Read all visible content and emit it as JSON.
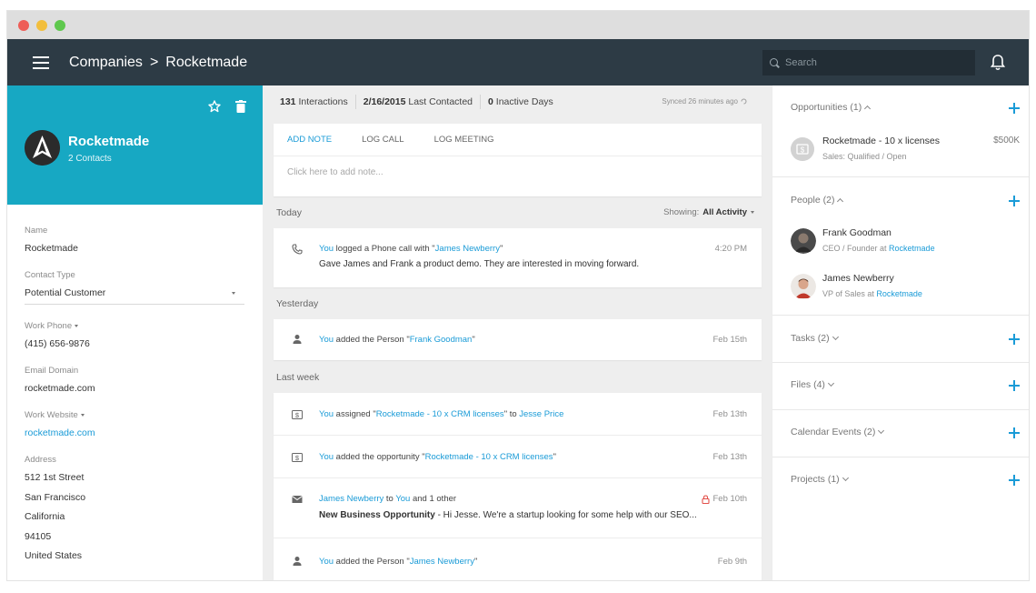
{
  "window": {
    "controls": [
      {
        "name": "close",
        "color": "#ee5e57"
      },
      {
        "name": "minimize",
        "color": "#f2be3c"
      },
      {
        "name": "maximize",
        "color": "#5ec84d"
      }
    ]
  },
  "header": {
    "breadcrumb_parent": "Companies",
    "breadcrumb_separator": ">",
    "breadcrumb_current": "Rocketmade",
    "search_placeholder": "Search",
    "menu_icon": "hamburger-icon",
    "notification_icon": "bell-icon"
  },
  "colors": {
    "topbar": "#2d3b45",
    "hero": "#17a8c3",
    "link": "#1a9bd7",
    "timeline_bg": "#eeeeee"
  },
  "company": {
    "name": "Rocketmade",
    "contacts": "2 Contacts",
    "fields": {
      "name_label": "Name",
      "name_value": "Rocketmade",
      "contact_type_label": "Contact Type",
      "contact_type_value": "Potential Customer",
      "work_phone_label": "Work Phone",
      "work_phone_value": "(415) 656-9876",
      "email_domain_label": "Email Domain",
      "email_domain_value": "rocketmade.com",
      "website_label": "Work Website",
      "website_value": "rocketmade.com",
      "address_label": "Address",
      "address_lines": [
        "512 1st Street",
        "San Francisco",
        "California",
        "94105",
        "United States"
      ]
    }
  },
  "stats": {
    "interactions_count": "131",
    "interactions_label": "Interactions",
    "last_contacted_date": "2/16/2015",
    "last_contacted_label": "Last Contacted",
    "inactive_count": "0",
    "inactive_label": "Inactive Days",
    "synced": "Synced 26 minutes ago"
  },
  "composer": {
    "tabs": [
      "ADD NOTE",
      "LOG CALL",
      "LOG MEETING"
    ],
    "placeholder": "Click here to add note..."
  },
  "activity": {
    "showing_label": "Showing:",
    "showing_value": "All Activity",
    "sections": [
      {
        "title": "Today",
        "items": [
          {
            "icon": "phone-icon",
            "actor": "You",
            "text": " logged a Phone call with \"",
            "link": "James Newberry",
            "suffix": "\"",
            "time": "4:20 PM",
            "detail": "Gave James and Frank a product demo. They are interested in moving forward."
          }
        ]
      },
      {
        "title": "Yesterday",
        "items": [
          {
            "icon": "person-icon",
            "actor": "You",
            "text": " added the Person \"",
            "link": "Frank Goodman",
            "suffix": "\"",
            "time": "Feb 15th"
          }
        ]
      },
      {
        "title": "Last week",
        "items": [
          {
            "icon": "dollar-icon",
            "actor": "You",
            "text": " assigned \"",
            "link": "Rocketmade - 10 x CRM licenses",
            "suffix": "\" to ",
            "link2": "Jesse Price",
            "time": "Feb 13th"
          },
          {
            "icon": "dollar-icon",
            "actor": "You",
            "text": " added the opportunity \"",
            "link": "Rocketmade - 10 x CRM licenses",
            "suffix": "\"",
            "time": "Feb 13th"
          },
          {
            "icon": "mail-icon",
            "actor": "James Newberry",
            "text": " to ",
            "link": "You",
            "suffix": " and 1 other",
            "time": "Feb 10th",
            "detail_bold": "New Business Opportunity",
            "detail": " - Hi Jesse. We're a startup looking for some help with our SEO..."
          },
          {
            "icon": "person-icon",
            "actor": "You",
            "text": " added the Person \"",
            "link": "James Newberry",
            "suffix": "\"",
            "time": "Feb 9th"
          }
        ]
      }
    ]
  },
  "sidebar": {
    "opportunities": {
      "title": "Opportunities (1)",
      "item_name": "Rocketmade - 10 x licenses",
      "item_sub": "Sales: Qualified / Open",
      "item_value": "$500K"
    },
    "people": {
      "title": "People (2)",
      "items": [
        {
          "name": "Frank Goodman",
          "role": "CEO / Founder at ",
          "company": "Rocketmade"
        },
        {
          "name": "James Newberry",
          "role": "VP of Sales at ",
          "company": "Rocketmade"
        }
      ]
    },
    "tasks_title": "Tasks (2)",
    "files_title": "Files (4)",
    "calendar_title": "Calendar Events (2)",
    "projects_title": "Projects (1)"
  }
}
